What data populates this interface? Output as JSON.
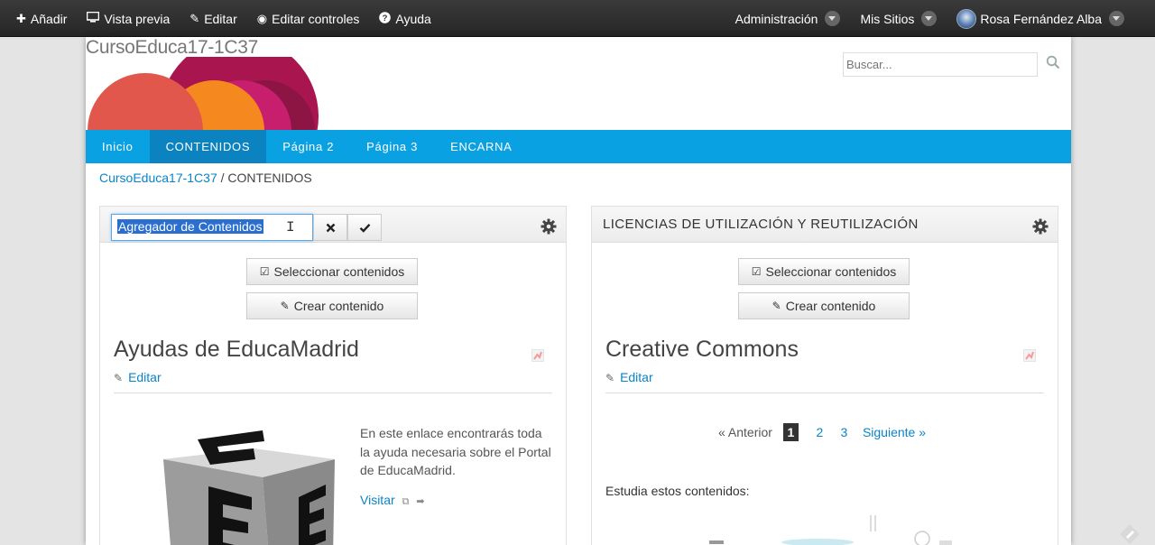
{
  "dock": {
    "left": [
      {
        "icon": "plus-icon",
        "glyph": "✚",
        "label": "Añadir"
      },
      {
        "icon": "monitor-icon",
        "glyph": "▭",
        "label": "Vista previa"
      },
      {
        "icon": "edit-icon",
        "glyph": "✎",
        "label": "Editar"
      },
      {
        "icon": "eye-icon",
        "glyph": "◉",
        "label": "Editar controles"
      },
      {
        "icon": "help-icon",
        "glyph": "?",
        "label": "Ayuda"
      }
    ],
    "admin_label": "Administración",
    "sites_label": "Mis Sitios",
    "user_name": "Rosa Fernández Alba"
  },
  "site": {
    "title": "CursoEduca17-1C37",
    "search_placeholder": "Buscar..."
  },
  "nav": {
    "items": [
      "Inicio",
      "CONTENIDOS",
      "Página 2",
      "Página 3",
      "ENCARNA"
    ],
    "active": "CONTENIDOS"
  },
  "breadcrumb": {
    "root": "CursoEduca17-1C37",
    "sep": "/",
    "current": "CONTENIDOS"
  },
  "left_portlet": {
    "title_value": "Agregador de Contenidos",
    "select_label": "Seleccionar contenidos",
    "create_label": "Crear contenido",
    "asset_title": "Ayudas de EducaMadrid",
    "edit_label": "Editar",
    "description": "En este enlace encontrarás toda la ayuda necesaria sobre el Portal de EducaMadrid.",
    "visit_label": "Visitar"
  },
  "right_portlet": {
    "title": "LICENCIAS DE UTILIZACIÓN Y REUTILIZACIÓN",
    "select_label": "Seleccionar contenidos",
    "create_label": "Crear contenido",
    "asset_title": "Creative Commons",
    "edit_label": "Editar",
    "pager": {
      "prev": "« Anterior",
      "pages": [
        "1",
        "2",
        "3"
      ],
      "current": "1",
      "next": "Siguiente »"
    },
    "intro": "Estudia estos contenidos:"
  },
  "colors": {
    "dock": "#2f2f2f",
    "nav": "#0aa1e2",
    "nav_active": "#0b83c0",
    "link": "#0a84c7"
  }
}
